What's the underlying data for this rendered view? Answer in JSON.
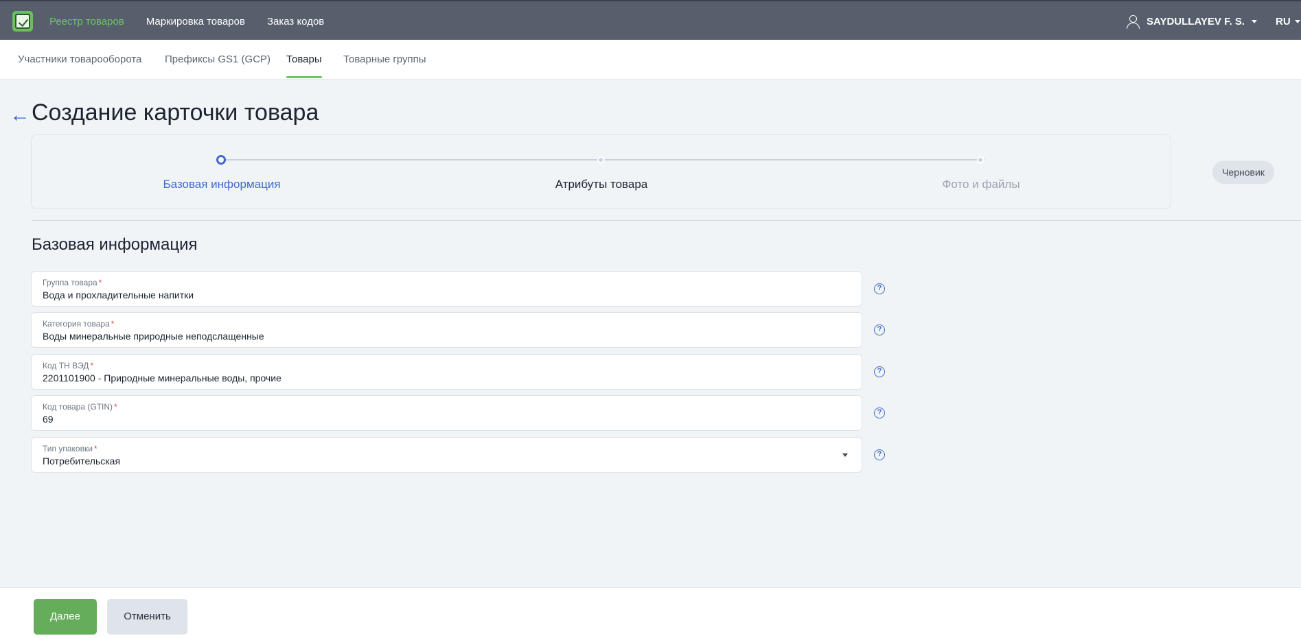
{
  "topbar": {
    "nav": [
      "Реестр товаров",
      "Маркировка товаров",
      "Заказ кодов"
    ],
    "user_name": "SAYDULLAYEV F. S.",
    "language": "RU"
  },
  "subnav": {
    "tabs": [
      "Участники товарооборота",
      "Префиксы GS1 (GCP)",
      "Товары",
      "Товарные группы"
    ],
    "active_tab": "Товары"
  },
  "page": {
    "title": "Создание карточки товара"
  },
  "stepper": {
    "steps": [
      "Базовая информация",
      "Атрибуты товара",
      "Фото и файлы"
    ],
    "current_step": 1,
    "status": "Черновик"
  },
  "form": {
    "section_title": "Базовая информация",
    "required_mark": "*",
    "fields": [
      {
        "label": "Группа товара",
        "value": "Вода и прохладительные напитки",
        "required": true
      },
      {
        "label": "Категория товара",
        "value": "Воды минеральные природные неподслащенные",
        "required": true
      },
      {
        "label": "Код ТН ВЭД",
        "value": "2201101900 - Природные минеральные воды, прочие",
        "required": true
      },
      {
        "label": "Код товара (GTIN)",
        "value": "69",
        "required": true
      },
      {
        "label": "Тип упаковки",
        "value": "Потребительская",
        "required": true,
        "dropdown": true
      }
    ]
  },
  "footer": {
    "next_label": "Далее",
    "cancel_label": "Отменить"
  },
  "colors": {
    "topbar": "#565f6b",
    "accent_green": "#6cc466",
    "primary_button": "#66ad5b",
    "link_blue": "#3c6bc9",
    "required": "#e0483e"
  }
}
